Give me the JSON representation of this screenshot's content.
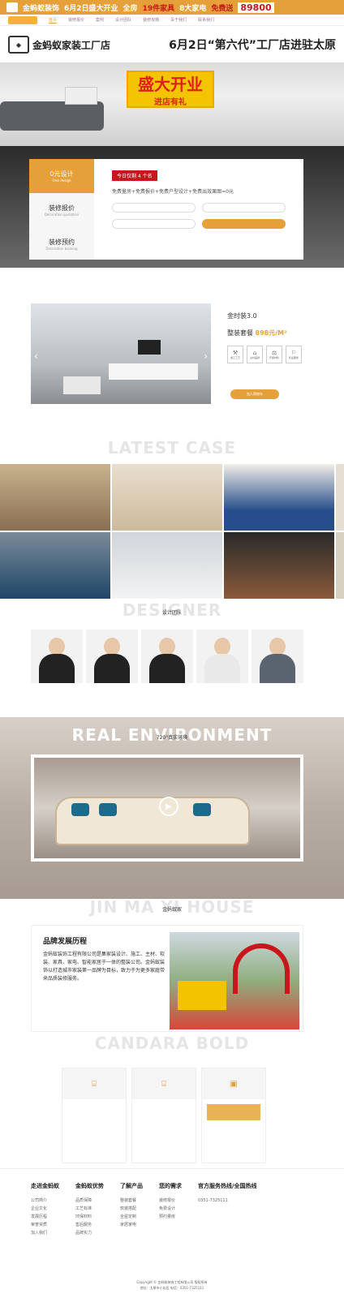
{
  "topbar": {
    "brand": "金蚂蚁装饰",
    "t1": "6月2日盛大开业",
    "t2": "全房",
    "t3": "19件家具",
    "t4": "8大家电",
    "t5": "免费送",
    "t6": "89800"
  },
  "nav": {
    "items": [
      "首页",
      "装修报价",
      "案例",
      "设计团队",
      "装修攻略",
      "关于我们",
      "联系我们"
    ]
  },
  "store": {
    "name": "金蚂蚁家装工厂店",
    "slogan": "6月2日“第六代”工厂店进驻太原"
  },
  "hero": {
    "banner1": "盛大开业",
    "banner2": "进店有礼"
  },
  "form": {
    "tabs": [
      {
        "label": "0元设计",
        "sub": "Free design"
      },
      {
        "label": "装修报价",
        "sub": "Decoration quotation"
      },
      {
        "label": "装修预约",
        "sub": "Decoration booking"
      }
    ],
    "badge": "今日仅剩 4 个名",
    "notice": "免费量房+免费报价+免费户型设计+免费出效果图=0元"
  },
  "pkg": {
    "title": "金时装3.0",
    "price_label": "整装套餐",
    "price": "898元/M²",
    "icons": [
      {
        "glyph": "⚒",
        "label": "施工工艺"
      },
      {
        "glyph": "⌂",
        "label": "主材品牌"
      },
      {
        "glyph": "⚖",
        "label": "环保材料"
      },
      {
        "glyph": "⚐",
        "label": "售后服务"
      }
    ],
    "join": "加入购物车"
  },
  "cases": {
    "big": "LATEST CASE"
  },
  "designers": {
    "big": "DESIGNER",
    "small": "设计团队"
  },
  "realEnv": {
    "big": "REAL ENVIRONMENT",
    "small": "720°真实环境"
  },
  "history": {
    "big": "JIN MA YI HOUSE",
    "small": "金蚂蚁家",
    "title": "品牌发展历程",
    "body": "金蚂蚁装饰工程有限公司是集家装设计、施工、主材、软装、家具、家电、智能家居于一体的整装公司。金蚂蚁装饰以打造城市家装第一品牌为目标，致力于为更多家庭带来品质装修服务。"
  },
  "adv": {
    "big": "CANDARA BOLD"
  },
  "footer": {
    "cols": [
      {
        "title": "走进金蚂蚁",
        "items": [
          "公司简介",
          "企业文化",
          "发展历程",
          "荣誉资质",
          "加入我们"
        ]
      },
      {
        "title": "金蚂蚁优势",
        "items": [
          "品质保障",
          "工艺标准",
          "环保材料",
          "售后服务",
          "品牌实力"
        ]
      },
      {
        "title": "了解产品",
        "items": [
          "整装套餐",
          "软装搭配",
          "全屋定制",
          "家居家电"
        ]
      },
      {
        "title": "您的需求",
        "items": [
          "装修报价",
          "免费设计",
          "预约量房"
        ]
      }
    ],
    "hotline_label": "官方服务热线/全国热线",
    "hotline": "0351-7325111",
    "copy1": "Copyright © 金蚂蚁装饰工程有限公司 版权所有",
    "copy2": "地址：太原市小店区 电话：0351-7325111"
  },
  "colors": {
    "accent": "#e6a03a",
    "red": "#c8161d"
  }
}
